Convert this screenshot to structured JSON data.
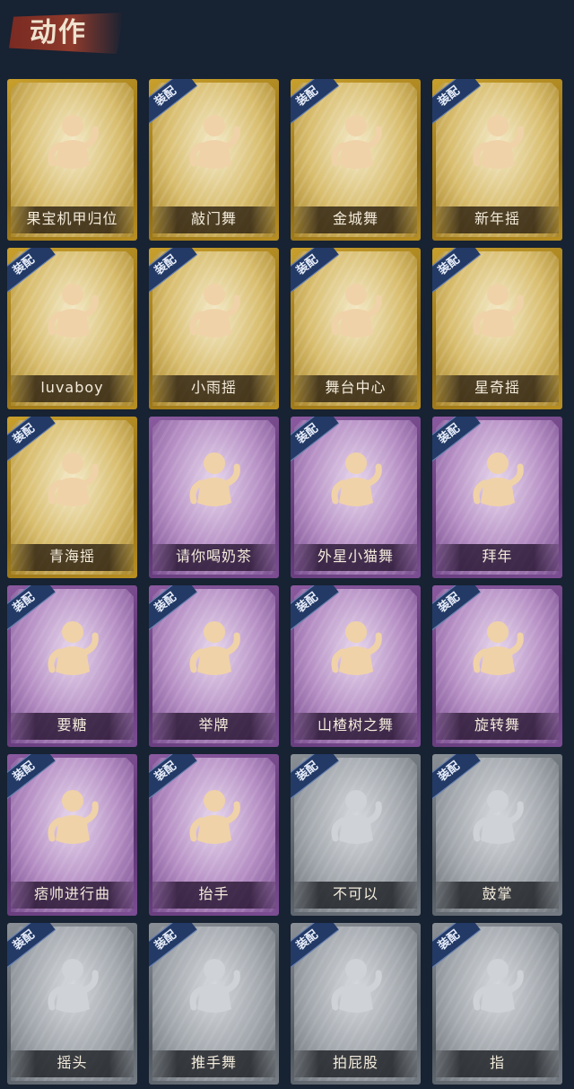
{
  "title": "动作",
  "equip_label": "装配",
  "cards": [
    {
      "label": "果宝机甲归位",
      "rarity": "gold",
      "equipped": false,
      "figure": "figure-dance"
    },
    {
      "label": "敲门舞",
      "rarity": "gold",
      "equipped": true,
      "figure": "figure-knock"
    },
    {
      "label": "金城舞",
      "rarity": "gold",
      "equipped": true,
      "figure": "figure-wave"
    },
    {
      "label": "新年摇",
      "rarity": "gold",
      "equipped": true,
      "figure": "figure-shake"
    },
    {
      "label": "luvaboy",
      "rarity": "gold",
      "equipped": true,
      "figure": "figure-dance"
    },
    {
      "label": "小雨摇",
      "rarity": "gold",
      "equipped": true,
      "figure": "figure-shake"
    },
    {
      "label": "舞台中心",
      "rarity": "gold",
      "equipped": true,
      "figure": "figure-pose"
    },
    {
      "label": "星奇摇",
      "rarity": "gold",
      "equipped": true,
      "figure": "figure-punch"
    },
    {
      "label": "青海摇",
      "rarity": "gold",
      "equipped": true,
      "figure": "figure-shake"
    },
    {
      "label": "请你喝奶茶",
      "rarity": "purple",
      "equipped": false,
      "figure": "figure-sign"
    },
    {
      "label": "外星小猫舞",
      "rarity": "purple",
      "equipped": true,
      "figure": "figure-dance"
    },
    {
      "label": "拜年",
      "rarity": "purple",
      "equipped": true,
      "figure": "figure-bow"
    },
    {
      "label": "要糖",
      "rarity": "purple",
      "equipped": true,
      "figure": "figure-reach"
    },
    {
      "label": "举牌",
      "rarity": "purple",
      "equipped": true,
      "figure": "figure-sign"
    },
    {
      "label": "山楂树之舞",
      "rarity": "purple",
      "equipped": true,
      "figure": "figure-raise"
    },
    {
      "label": "旋转舞",
      "rarity": "purple",
      "equipped": true,
      "figure": "figure-spin"
    },
    {
      "label": "痞帅进行曲",
      "rarity": "purple",
      "equipped": true,
      "figure": "figure-flex"
    },
    {
      "label": "抬手",
      "rarity": "purple",
      "equipped": true,
      "figure": "figure-reach"
    },
    {
      "label": "不可以",
      "rarity": "gray",
      "equipped": true,
      "figure": "figure-finger"
    },
    {
      "label": "鼓掌",
      "rarity": "gray",
      "equipped": true,
      "figure": "figure-clap"
    },
    {
      "label": "摇头",
      "rarity": "gray",
      "equipped": true,
      "figure": "figure-pose"
    },
    {
      "label": "推手舞",
      "rarity": "gray",
      "equipped": true,
      "figure": "figure-push"
    },
    {
      "label": "拍屁股",
      "rarity": "gray",
      "equipped": true,
      "figure": "figure-walk"
    },
    {
      "label": "指",
      "rarity": "gray",
      "equipped": true,
      "figure": "figure-point"
    }
  ]
}
